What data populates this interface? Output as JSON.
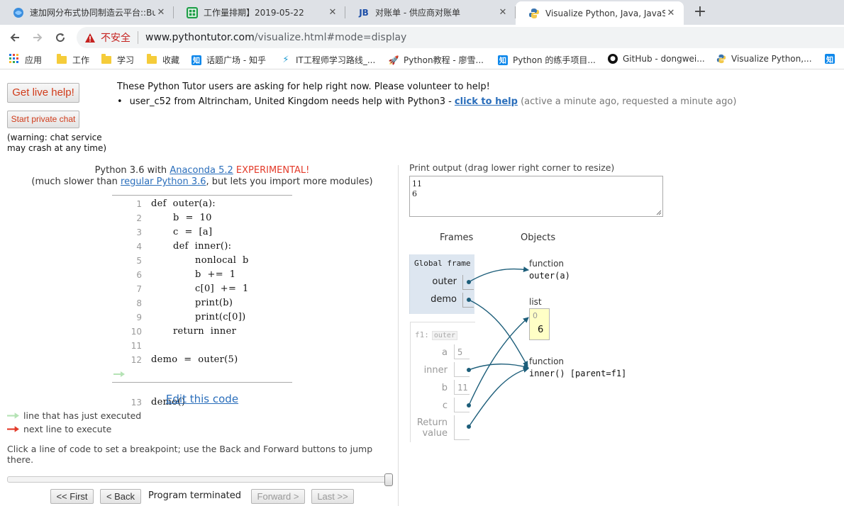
{
  "browser": {
    "tabs": [
      {
        "title": "速加网分布式协同制造云平台::Bu",
        "icon": "edge-globe-icon",
        "active": false
      },
      {
        "title": "工作量排期】2019-05-22",
        "icon": "sheet-icon",
        "active": false
      },
      {
        "title": "对账单 - 供应商对账单",
        "icon": "jb-logo-icon",
        "active": false
      },
      {
        "title": "Visualize Python, Java, JavaScri",
        "icon": "python-logo-icon",
        "active": true
      }
    ],
    "new_tab": "+",
    "security_label": "不安全",
    "url_host": "www.pythontutor.com",
    "url_rest": "/visualize.html#mode=display",
    "bookmarks": [
      {
        "label": "应用",
        "icon": "apps-grid-icon"
      },
      {
        "label": "工作",
        "icon": "folder-icon"
      },
      {
        "label": "学习",
        "icon": "folder-icon"
      },
      {
        "label": "收藏",
        "icon": "folder-icon"
      },
      {
        "label": "话题广场 - 知乎",
        "icon": "zhihu-icon"
      },
      {
        "label": "IT工程师学习路线_...",
        "icon": "lightning-icon"
      },
      {
        "label": "Python教程 - 廖雪...",
        "icon": "rocket-icon"
      },
      {
        "label": "Python 的练手项目...",
        "icon": "zhihu-icon"
      },
      {
        "label": "GitHub - dongwei...",
        "icon": "github-icon"
      },
      {
        "label": "Visualize Python,...",
        "icon": "python-logo-icon"
      }
    ],
    "bookmark_overflow_icon": "知"
  },
  "help": {
    "live_help": "Get live help!",
    "private_chat": "Start private chat",
    "warning_line1": "(warning: chat service",
    "warning_line2": "may crash at any time)",
    "headline": "These Python Tutor users are asking for help right now. Please volunteer to help!",
    "request_text": "user_c52 from Altrincham, United Kingdom needs help with Python3 - ",
    "request_link": "click to help",
    "request_note": " (active a minute ago, requested a minute ago)"
  },
  "editor": {
    "lang_prefix": "Python 3.6 with ",
    "lang_link": "Anaconda 5.2",
    "lang_experimental": " EXPERIMENTAL!",
    "note_prefix": "(much slower than ",
    "note_link": "regular Python 3.6",
    "note_suffix": ", but lets you import more modules)",
    "code_lines": [
      {
        "n": "1",
        "text": "def  outer(a):"
      },
      {
        "n": "2",
        "text": "       b  =  10"
      },
      {
        "n": "3",
        "text": "       c  =  [a]"
      },
      {
        "n": "4",
        "text": "       def  inner():"
      },
      {
        "n": "5",
        "text": "              nonlocal  b"
      },
      {
        "n": "6",
        "text": "              b  +=  1"
      },
      {
        "n": "7",
        "text": "              c[0]  +=  1"
      },
      {
        "n": "8",
        "text": "              print(b)"
      },
      {
        "n": "9",
        "text": "              print(c[0])"
      },
      {
        "n": "10",
        "text": "       return  inner"
      },
      {
        "n": "11",
        "text": ""
      },
      {
        "n": "12",
        "text": "demo  =  outer(5)"
      },
      {
        "n": "13",
        "text": "demo()"
      }
    ],
    "edit_link": "Edit this code",
    "legend_just_executed": "line that has just executed",
    "legend_next_line": "next line to execute",
    "breakpoint_note": "Click a line of code to set a breakpoint; use the Back and Forward buttons to jump there.",
    "first_btn": "<< First",
    "back_btn": "< Back",
    "status": "Program terminated",
    "forward_btn": "Forward >",
    "last_btn": "Last >>"
  },
  "visual": {
    "print_label": "Print output (drag lower right corner to resize)",
    "print_output": [
      "11",
      "6"
    ],
    "frames_header": "Frames",
    "objects_header": "Objects",
    "global_frame_title": "Global frame",
    "global_vars": [
      "outer",
      "demo"
    ],
    "f1_title": "f1:",
    "f1_tag": "outer",
    "f1_vars": {
      "a": "a",
      "a_val": "5",
      "inner": "inner",
      "b": "b",
      "b_val": "11",
      "c": "c",
      "ret1": "Return",
      "ret2": "value"
    },
    "obj_outer_type": "function",
    "obj_outer_val": "outer(a)",
    "obj_list_type": "list",
    "obj_list_index": "0",
    "obj_list_value": "6",
    "obj_inner_type": "function",
    "obj_inner_val": "inner() [parent=f1]"
  },
  "colors": {
    "arrow": "#1d5e7a",
    "error_red": "#d03b1a",
    "link_blue": "#2a6ebb",
    "frame_bg": "#dde6f0",
    "list_bg": "#ffffc6"
  }
}
